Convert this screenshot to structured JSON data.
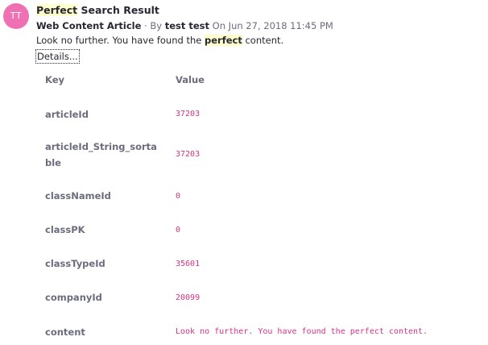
{
  "avatar": {
    "initials": "TT",
    "color": "#f070b4"
  },
  "result": {
    "title_highlight": "Perfect",
    "title_rest": " Search Result",
    "type": "Web Content Article",
    "by_prefix": " · By ",
    "user": "test test",
    "date_text": " On Jun 27, 2018 11:45 PM",
    "desc_before": "Look no further. You have found the ",
    "desc_highlight": "perfect",
    "desc_after": " content."
  },
  "details": {
    "toggle_label": "Details...",
    "columns": {
      "key": "Key",
      "value": "Value"
    },
    "rows": [
      {
        "key": "articleId",
        "value": "37203"
      },
      {
        "key": "articleId_String_sortable",
        "value": "37203"
      },
      {
        "key": "classNameId",
        "value": "0"
      },
      {
        "key": "classPK",
        "value": "0"
      },
      {
        "key": "classTypeId",
        "value": "35601"
      },
      {
        "key": "companyId",
        "value": "20099"
      },
      {
        "key": "content",
        "value": "Look no further. You have found the perfect content."
      }
    ]
  },
  "colors": {
    "highlight": "#ffffcc",
    "value_text": "#d63384",
    "muted_text": "#6b6c7e"
  }
}
